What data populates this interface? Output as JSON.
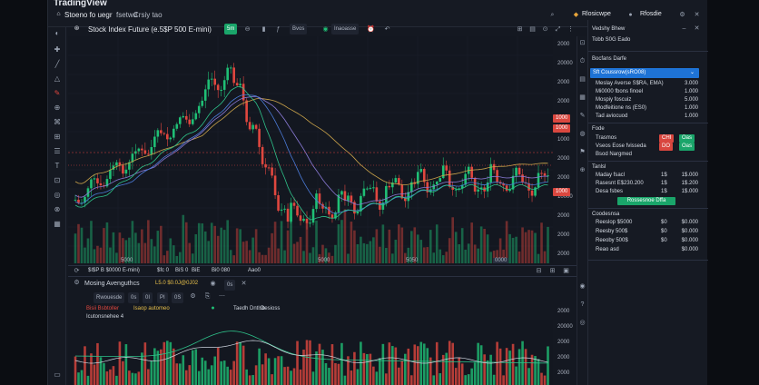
{
  "app": {
    "brand": "TradingView"
  },
  "topbar": {
    "tab_title": "Stoeno fo uegr",
    "tab_sub1": "fsetwd",
    "tab_sub2": "Crsiy tao",
    "account": "Rlosicwpe",
    "status": "Rfosdie"
  },
  "chart": {
    "title": "Stock Index Future (e.5$P 500 E-mini)",
    "badge": "5m",
    "toolbar_label": "Bvos",
    "layout_label": "Inaoasse",
    "axis_prices": [
      "2000",
      "20000",
      "2000",
      "2000",
      "2000",
      "1000",
      "2000",
      "2000",
      "10000",
      "2000",
      "2000",
      "2000"
    ],
    "time_labels": [
      "5000",
      "5000",
      "5050"
    ],
    "price_tags": [
      "1000",
      "1000",
      "1000"
    ],
    "bottom_strip": [
      "$I$P B $0000 E-mini)",
      "$fc 0",
      "BiS 0",
      "BiE",
      "Bi0 080",
      "Aao0"
    ],
    "bottom_right": "0000"
  },
  "indicator": {
    "name": "Mosing Avenguthcs",
    "value_label": "L5.0  $0.0J@0J02",
    "row_labels": [
      "Rwouesde",
      "0s",
      "0I",
      "PI",
      "0S",
      "0s"
    ],
    "legend_red": "Bisii Bsbtoller",
    "legend_yellow": "Isaop automeo",
    "legend_title": "Taedh Dntlsb",
    "legend_extra": "Desioss",
    "sub_label": "Icutonsnehee 4",
    "axis": [
      "2000",
      "20000",
      "2000",
      "2000",
      "2000"
    ]
  },
  "panel": {
    "title": "Vedshy Bhew",
    "sub_title": "Tobb S0G Eado",
    "section_title": "Bocfans Darfe",
    "selected": "Sft Coussrow(sRO08)",
    "rows": [
      {
        "label": "Meslay Averse S$RA, EMA)",
        "value": "3.000"
      },
      {
        "label": "Mi0000 fbons finoel",
        "value": "1.000"
      },
      {
        "label": "Mospiy foscuiz",
        "value": "5.000"
      },
      {
        "label": "Modfeitione ns (ES0)",
        "value": "1.000"
      },
      {
        "label": "Tad aviocuod",
        "value": "1.000"
      }
    ],
    "fade_title": "Fode",
    "fade_rows": [
      {
        "label": "Trasmos",
        "tag1": "CHI",
        "tag2": "Oas"
      },
      {
        "label": "Vseos Eose fvisseda",
        "tag1": "DO",
        "tag2": "Oas"
      },
      {
        "label": "Bsod Nargmed",
        "tag1": "",
        "tag2": ""
      }
    ],
    "trades_title": "Tanlsl",
    "trades": [
      {
        "label": "Maday fsacl",
        "v1": "1$",
        "v2": "1$.000"
      },
      {
        "label": "Rasesnt E$230.200",
        "v1": "1$",
        "v2": "1$.200"
      },
      {
        "label": "Desa fsbes",
        "v1": "1$",
        "v2": "1$.000"
      }
    ],
    "trade_button": "Rossesnoe Dffa",
    "orders_title": "Coodesnsa",
    "orders": [
      {
        "label": "Reeslop $5000",
        "v1": "$0",
        "v2": "$0.000"
      },
      {
        "label": "Reesby 500$",
        "v1": "$0",
        "v2": "$0.000"
      },
      {
        "label": "Reeoby 500$",
        "v1": "$0",
        "v2": "$0.000"
      },
      {
        "label": "Reao asd",
        "v1": "",
        "v2": "$0.000"
      }
    ]
  },
  "colors": {
    "up": "#1fbf75",
    "down": "#e0473f",
    "accent": "#2962ff",
    "ma_yellow": "#c9a24a",
    "ma_purple": "#8a7ad6",
    "ma_blue": "#4b7bd8",
    "ma_teal": "#2ec28a"
  }
}
